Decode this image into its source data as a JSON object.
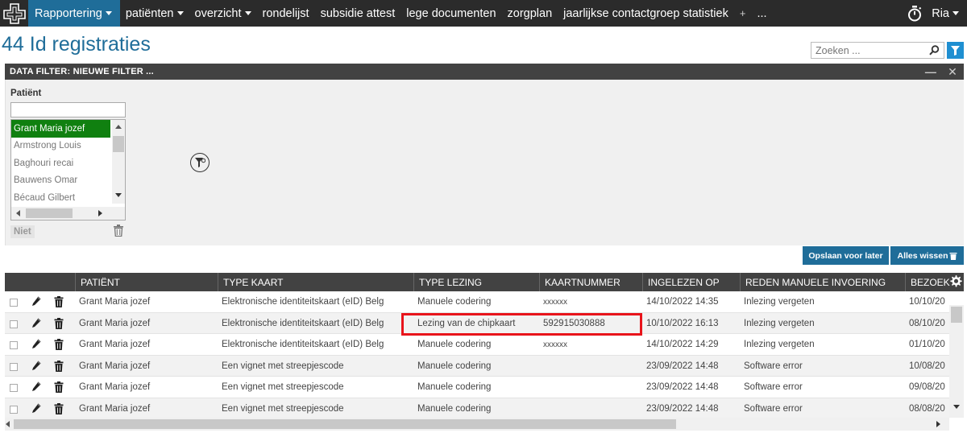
{
  "nav": {
    "items": [
      {
        "label": "Rapportering",
        "dropdown": true
      },
      {
        "label": "patiënten",
        "dropdown": true
      },
      {
        "label": "overzicht",
        "dropdown": true
      },
      {
        "label": "rondelijst",
        "dropdown": false
      },
      {
        "label": "subsidie attest",
        "dropdown": false
      },
      {
        "label": "lege documenten",
        "dropdown": false
      },
      {
        "label": "zorgplan",
        "dropdown": false
      },
      {
        "label": "jaarlijkse contactgroep statistiek",
        "dropdown": false
      },
      {
        "label": "+",
        "dropdown": false
      },
      {
        "label": "...",
        "dropdown": false
      }
    ],
    "user": "Ria",
    "accent": "#1f6d99"
  },
  "page": {
    "title": "44 Id registraties",
    "search_placeholder": "Zoeken ..."
  },
  "filter": {
    "header": "DATA FILTER: NIEUWE FILTER ...",
    "patient_label": "Patiënt",
    "patients": [
      "Grant Maria jozef",
      "Armstrong Louis",
      "Baghouri recai",
      "Bauwens Omar",
      "Bécaud Gilbert"
    ],
    "selected_patient": "Grant Maria jozef",
    "niet_label": "Niet",
    "save_label": "Opslaan voor later",
    "clear_label": "Alles wissen"
  },
  "table": {
    "columns": [
      "PATIËNT",
      "TYPE KAART",
      "TYPE LEZING",
      "KAARTNUMMER",
      "INGELEZEN OP",
      "REDEN MANUELE INVOERING",
      "BEZOEK"
    ],
    "rows": [
      [
        "Grant Maria jozef",
        "Elektronische identiteitskaart (eID) Belg",
        "Manuele codering",
        "xxxxxx",
        "14/10/2022 14:35",
        "Inlezing vergeten",
        "10/10/20"
      ],
      [
        "Grant Maria jozef",
        "Elektronische identiteitskaart (eID) Belg",
        "Lezing van de chipkaart",
        "592915030888",
        "10/10/2022 16:13",
        "Inlezing vergeten",
        "08/10/20"
      ],
      [
        "Grant Maria jozef",
        "Elektronische identiteitskaart (eID) Belg",
        "Manuele codering",
        "xxxxxx",
        "14/10/2022 14:29",
        "Inlezing vergeten",
        "01/10/20"
      ],
      [
        "Grant Maria jozef",
        "Een vignet met streepjescode",
        "Manuele codering",
        "",
        "23/09/2022 14:48",
        "Software error",
        "10/08/20"
      ],
      [
        "Grant Maria jozef",
        "Een vignet met streepjescode",
        "Manuele codering",
        "",
        "23/09/2022 14:48",
        "Software error",
        "09/08/20"
      ],
      [
        "Grant Maria jozef",
        "Een vignet met streepjescode",
        "Manuele codering",
        "",
        "23/09/2022 14:48",
        "Software error",
        "08/08/20"
      ]
    ],
    "highlight_color": "#e8141b"
  }
}
